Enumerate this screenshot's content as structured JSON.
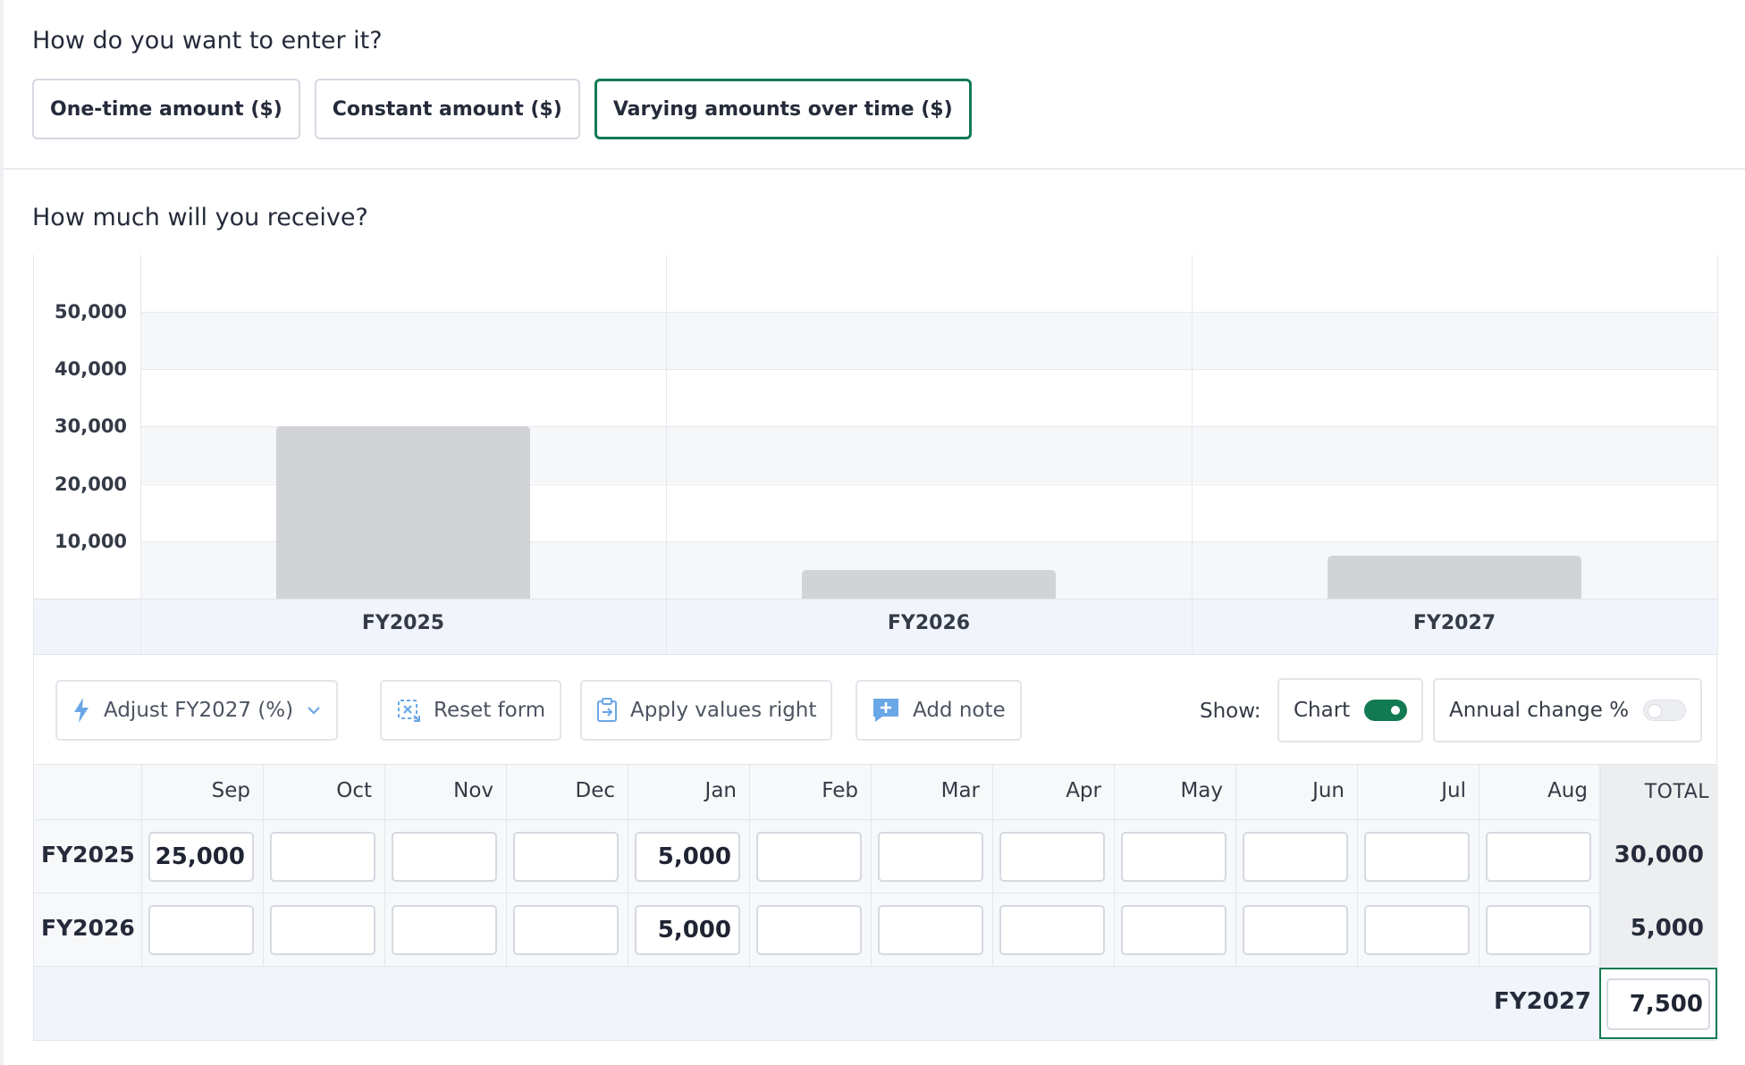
{
  "entry": {
    "question": "How do you want to enter it?",
    "options": [
      "One-time amount ($)",
      "Constant amount ($)",
      "Varying amounts over time ($)"
    ],
    "selected_index": 2
  },
  "receive": {
    "question": "How much will you receive?"
  },
  "chart_data": {
    "type": "bar",
    "categories": [
      "FY2025",
      "FY2026",
      "FY2027"
    ],
    "values": [
      30000,
      5000,
      7500
    ],
    "y_ticks": [
      "10,000",
      "20,000",
      "30,000",
      "40,000",
      "50,000"
    ],
    "ylim": [
      0,
      60000
    ],
    "grid": true,
    "bar_color": "#d2d3d7"
  },
  "toolbar": {
    "adjust_label": "Adjust FY2027 (%)",
    "reset_label": "Reset form",
    "apply_label": "Apply values right",
    "note_label": "Add note",
    "show_label": "Show:",
    "chart_toggle_label": "Chart",
    "chart_toggle_on": true,
    "annual_change_label": "Annual change %",
    "annual_change_on": false,
    "accent_color": "#127a52"
  },
  "table": {
    "months": [
      "Sep",
      "Oct",
      "Nov",
      "Dec",
      "Jan",
      "Feb",
      "Mar",
      "Apr",
      "May",
      "Jun",
      "Jul",
      "Aug"
    ],
    "total_header": "TOTAL",
    "rows": [
      {
        "label": "FY2025",
        "values": [
          "25,000",
          "",
          "",
          "",
          "5,000",
          "",
          "",
          "",
          "",
          "",
          "",
          ""
        ],
        "total": "30,000"
      },
      {
        "label": "FY2026",
        "values": [
          "",
          "",
          "",
          "",
          "5,000",
          "",
          "",
          "",
          "",
          "",
          "",
          ""
        ],
        "total": "5,000"
      }
    ],
    "footer": {
      "label": "FY2027",
      "value": "7,500"
    }
  }
}
